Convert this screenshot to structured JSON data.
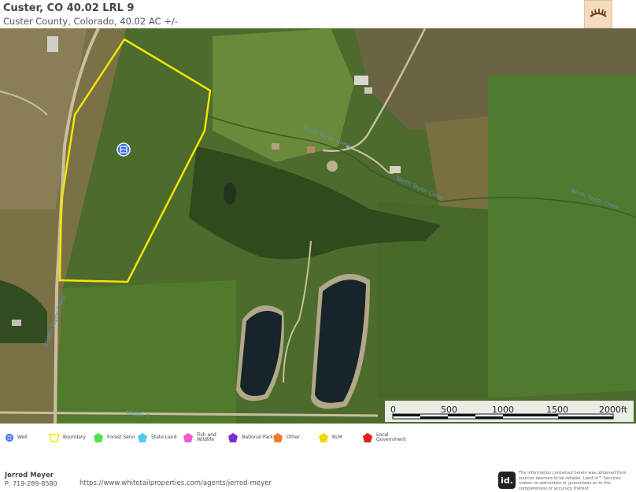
{
  "header": {
    "title": "Custer, CO 40.02 LRL 9",
    "subtitle": "Custer County, Colorado, 40.02 AC +/-"
  },
  "map": {
    "creek_labels": [
      "North Taylor Creek",
      "North Taylor Creek",
      "North Taylor Creek",
      "Middle Taylor Creek",
      "Middle T"
    ],
    "boundary_color": "#f2e600",
    "scale_bar": {
      "ticks": [
        "0",
        "500",
        "1000",
        "1500",
        "2000ft"
      ]
    },
    "markers": [
      {
        "type": "well",
        "icon": "water-drop-icon"
      }
    ]
  },
  "legend": [
    {
      "label": "Well",
      "icon": "well-icon",
      "color": "#3a6ee8"
    },
    {
      "label": "Boundary",
      "icon": "boundary-icon",
      "color": "#f2e600"
    },
    {
      "label": "Forest Servi",
      "icon": "forest-service-icon",
      "color": "#54e04a"
    },
    {
      "label": "State Land",
      "icon": "state-land-icon",
      "color": "#56c8f0"
    },
    {
      "label": "Fish and Wildlife",
      "icon": "fish-wildlife-icon",
      "color": "#f25ad6"
    },
    {
      "label": "National Park",
      "icon": "national-park-icon",
      "color": "#7b2ec8"
    },
    {
      "label": "Other",
      "icon": "other-icon",
      "color": "#f27a2e"
    },
    {
      "label": "BLM",
      "icon": "blm-icon",
      "color": "#f2d60e"
    },
    {
      "label": "Local Government",
      "icon": "local-government-icon",
      "color": "#e81c1c"
    }
  ],
  "footer": {
    "agent_name": "Jerrod Meyer",
    "agent_phone": "P: 719-289-8580",
    "agent_url": "https://www.whitetailproperties.com/agents/jerrod-meyer",
    "id_logo": "id.",
    "disclaimer": "The information contained herein was obtained from sources deemed to be reliable. Land id™ Services makes no warranties or guarantees as to the completeness or accuracy thereof."
  }
}
